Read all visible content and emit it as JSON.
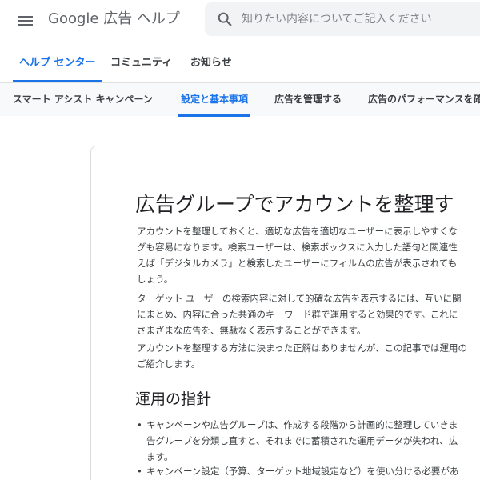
{
  "header": {
    "product_title": "Google 広告 ヘルプ",
    "search_placeholder": "知りたい内容についてご記入ください",
    "icons": {
      "menu": "hamburger-menu-icon",
      "search": "search-icon"
    }
  },
  "primary_nav": {
    "tabs": [
      {
        "label": "ヘルプ センター",
        "active": true
      },
      {
        "label": "コミュニティ",
        "active": false
      },
      {
        "label": "お知らせ",
        "active": false
      }
    ]
  },
  "secondary_nav": {
    "tabs": [
      {
        "label": "スマート アシスト キャンペーン",
        "active": false
      },
      {
        "label": "設定と基本事項",
        "active": true
      },
      {
        "label": "広告を管理する",
        "active": false
      },
      {
        "label": "広告のパフォーマンスを確",
        "active": false
      }
    ]
  },
  "article": {
    "title": "広告グループでアカウントを整理す",
    "paragraphs": [
      [
        "アカウントを整理しておくと、適切な広告を適切なユーザーに表示しやすくな",
        "グも容易になります。検索ユーザーは、検索ボックスに入力した語句と関連性",
        "えば「デジタルカメラ」と検索したユーザーにフィルムの広告が表示されても",
        "しょう。"
      ],
      [
        "ターゲット ユーザーの検索内容に対して的確な広告を表示するには、互いに関",
        "にまとめ、内容に合った共通のキーワード群で運用すると効果的です。これに",
        "さまざまな広告を、無駄なく表示することができます。"
      ],
      [
        "アカウントを整理する方法に決まった正解はありませんが、この記事では運用の",
        "ご紹介します。"
      ]
    ],
    "section_heading": "運用の指針",
    "bullets": [
      [
        "キャンペーンや広告グループは、作成する段階から計画的に整理していきま",
        "告グループを分類し直すと、それまでに蓄積された運用データが失われ、広",
        "ます。"
      ],
      [
        "キャンペーン設定（予算、ターゲット地域設定など）を使い分ける必要があ"
      ]
    ],
    "bullet_char": "•"
  },
  "colors": {
    "accent": "#1a73e8",
    "text": "#202124",
    "muted": "#5f6368",
    "nav_bg": "#f8f9fa"
  }
}
